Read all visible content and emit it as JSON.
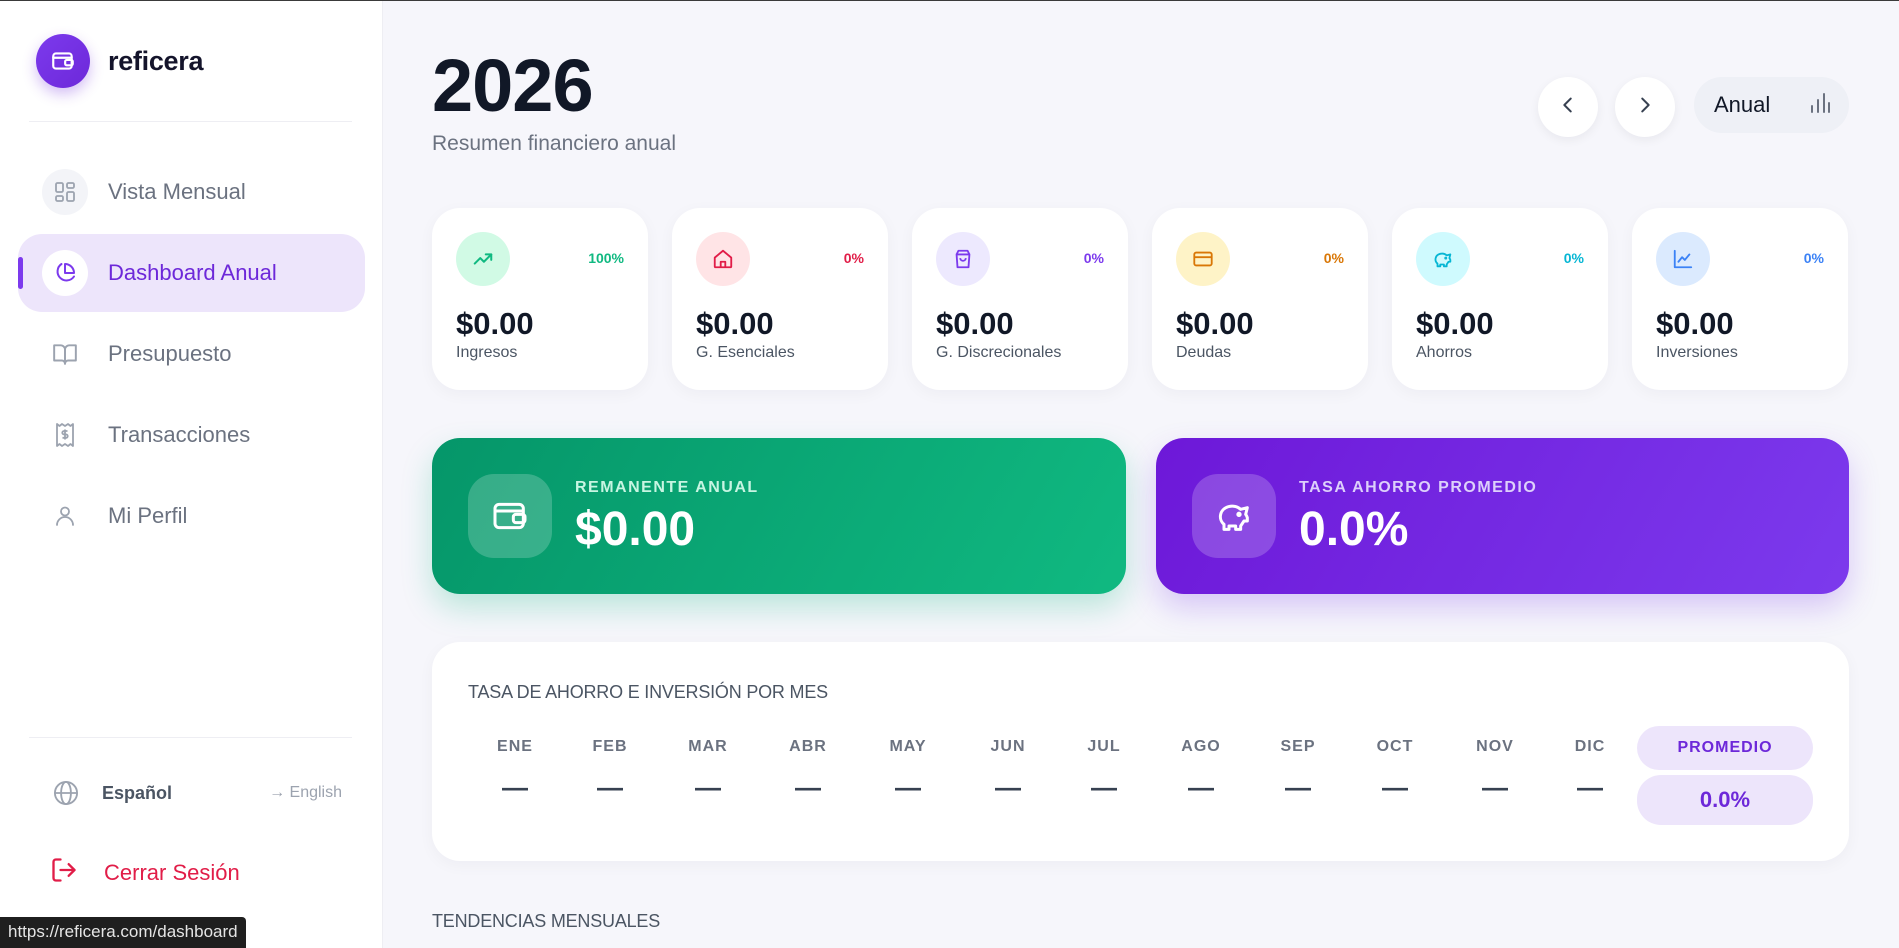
{
  "browser": {
    "status_url": "https://reficera.com/dashboard"
  },
  "brand": {
    "name": "reficera"
  },
  "sidebar": {
    "items": [
      {
        "label": "Vista Mensual",
        "icon": "grid-icon",
        "active": false
      },
      {
        "label": "Dashboard Anual",
        "icon": "pie-chart-icon",
        "active": true
      },
      {
        "label": "Presupuesto",
        "icon": "book-icon",
        "active": false
      },
      {
        "label": "Transacciones",
        "icon": "receipt-icon",
        "active": false
      },
      {
        "label": "Mi Perfil",
        "icon": "user-icon",
        "active": false
      }
    ],
    "language": {
      "current": "Español",
      "alternate": "→ English"
    },
    "logout_label": "Cerrar Sesión"
  },
  "header": {
    "year": "2026",
    "subtitle": "Resumen financiero anual",
    "view_label": "Anual"
  },
  "stats": [
    {
      "name": "Ingresos",
      "value": "$0.00",
      "percent": "100%",
      "icon": "trending-up-icon",
      "accent": "#10b981",
      "bg": "#d1fae5"
    },
    {
      "name": "G. Esenciales",
      "value": "$0.00",
      "percent": "0%",
      "icon": "home-icon",
      "accent": "#e11d48",
      "bg": "#ffe4e6"
    },
    {
      "name": "G. Discrecionales",
      "value": "$0.00",
      "percent": "0%",
      "icon": "shopping-bag-icon",
      "accent": "#7c3aed",
      "bg": "#ede9fe"
    },
    {
      "name": "Deudas",
      "value": "$0.00",
      "percent": "0%",
      "icon": "credit-card-icon",
      "accent": "#d97706",
      "bg": "#fef3c7"
    },
    {
      "name": "Ahorros",
      "value": "$0.00",
      "percent": "0%",
      "icon": "piggy-bank-icon",
      "accent": "#06b6d4",
      "bg": "#cffafe"
    },
    {
      "name": "Inversiones",
      "value": "$0.00",
      "percent": "0%",
      "icon": "line-chart-icon",
      "accent": "#3b82f6",
      "bg": "#dbeafe"
    }
  ],
  "summary": {
    "remaining": {
      "caption": "REMANENTE ANUAL",
      "value": "$0.00"
    },
    "savings_rate": {
      "caption": "TASA AHORRO PROMEDIO",
      "value": "0.0%"
    }
  },
  "monthly_rate": {
    "title": "TASA DE AHORRO E INVERSIÓN POR MES",
    "months": [
      {
        "m": "ENE",
        "v": "—"
      },
      {
        "m": "FEB",
        "v": "—"
      },
      {
        "m": "MAR",
        "v": "—"
      },
      {
        "m": "ABR",
        "v": "—"
      },
      {
        "m": "MAY",
        "v": "—"
      },
      {
        "m": "JUN",
        "v": "—"
      },
      {
        "m": "JUL",
        "v": "—"
      },
      {
        "m": "AGO",
        "v": "—"
      },
      {
        "m": "SEP",
        "v": "—"
      },
      {
        "m": "OCT",
        "v": "—"
      },
      {
        "m": "NOV",
        "v": "—"
      },
      {
        "m": "DIC",
        "v": "—"
      }
    ],
    "average_label": "PROMEDIO",
    "average_value": "0.0%"
  },
  "trends_title": "TENDENCIAS MENSUALES"
}
